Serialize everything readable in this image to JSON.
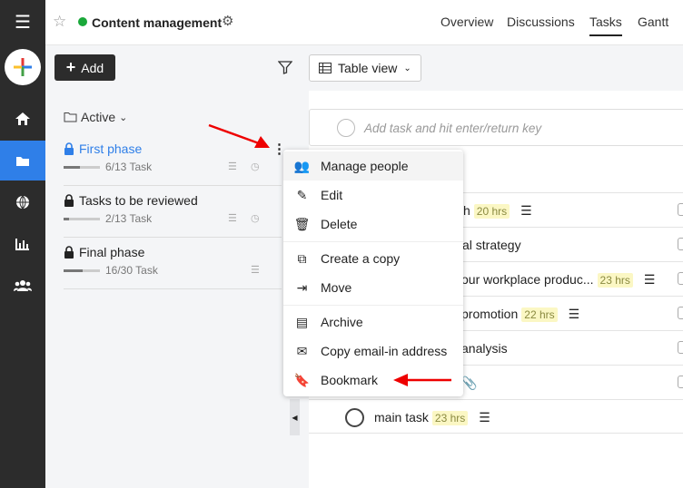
{
  "header": {
    "title": "Content management",
    "status_color": "#1aa83a",
    "tabs": [
      "Overview",
      "Discussions",
      "Tasks",
      "Gantt"
    ],
    "active_tab": "Tasks"
  },
  "toolbar": {
    "add_label": "Add",
    "view_label": "Table view"
  },
  "sidebar": {
    "icons": [
      "menu-icon",
      "add-icon",
      "home-icon",
      "folder-icon",
      "globe-icon",
      "chart-icon",
      "people-icon"
    ],
    "active": "folder-icon",
    "accent": "#2f7fe8"
  },
  "left": {
    "filter_label": "Active",
    "phases": [
      {
        "name": "First phase",
        "tasks": "6/13 Task",
        "progress": 0.46,
        "active": true
      },
      {
        "name": "Tasks to be reviewed",
        "tasks": "2/13 Task",
        "progress": 0.15,
        "active": false
      },
      {
        "name": "Final phase",
        "tasks": "16/30 Task",
        "progress": 0.53,
        "active": false
      }
    ]
  },
  "task_input": {
    "placeholder": "Add task and hit enter/return key"
  },
  "menu": {
    "items": [
      "Manage people",
      "Edit",
      "Delete",
      "Create a copy",
      "Move",
      "Archive",
      "Copy email-in address",
      "Bookmark"
    ]
  },
  "tasks": [
    {
      "text": "h",
      "hrs": "20 hrs"
    },
    {
      "text": "al strategy",
      "hrs": ""
    },
    {
      "text": "our workplace produc...",
      "hrs": "23 hrs"
    },
    {
      "text": "promotion",
      "hrs": "22 hrs"
    },
    {
      "text": "analysis",
      "hrs": ""
    },
    {
      "text": "",
      "hrs": ""
    },
    {
      "text": "main task",
      "hrs": "23 hrs"
    }
  ]
}
